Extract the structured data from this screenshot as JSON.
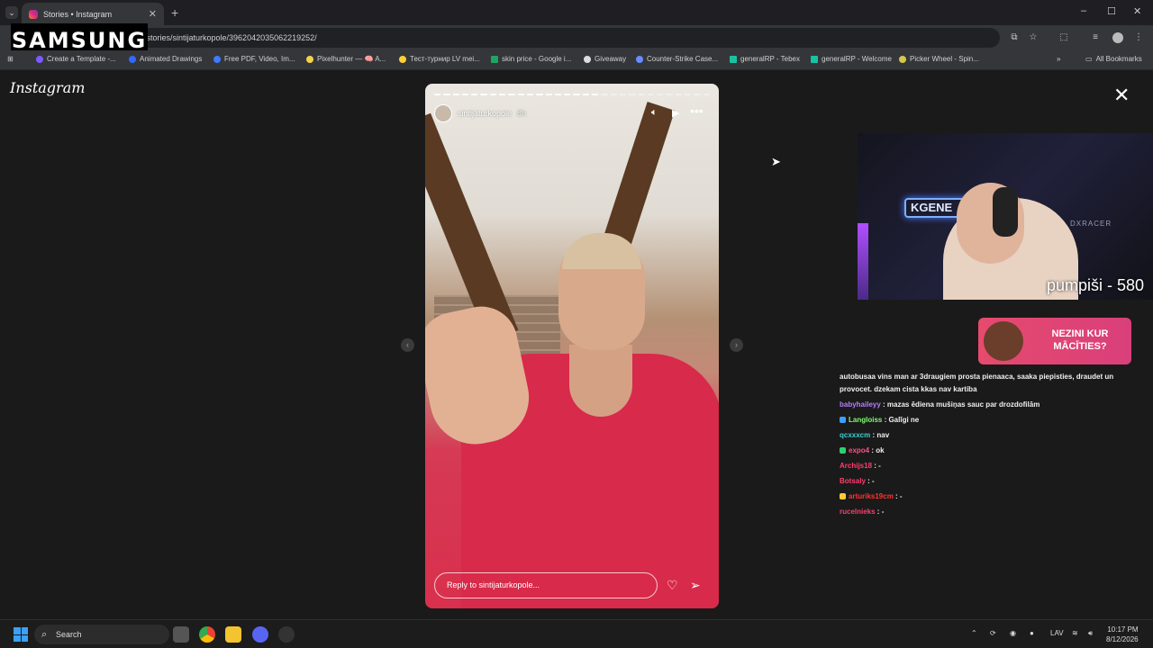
{
  "browser": {
    "tab_title": "Stories • Instagram",
    "new_tab": "+",
    "url": "/stories/sintijaturkopole/3962042035062219252/",
    "window_controls": [
      "–",
      "☐",
      "✕"
    ]
  },
  "watermark": "SAMSUNG",
  "bookmarks": [
    {
      "label": "Create a Template -...",
      "color": "#7c5cff"
    },
    {
      "label": "Animated Drawings",
      "color": "#2f6bff"
    },
    {
      "label": "Free PDF, Video, Im...",
      "color": "#3e7bff"
    },
    {
      "label": "Pixelhunter — 🧠 A...",
      "color": "#f3d34a"
    },
    {
      "label": "Тест-турнир LV mei...",
      "color": "#ffcf33"
    },
    {
      "label": "skin price - Google i...",
      "color": "#1fa463"
    },
    {
      "label": "Giveaway",
      "color": "#dddddd"
    },
    {
      "label": "Counter-Strike Case...",
      "color": "#6b8cff"
    },
    {
      "label": "generalRP - Tebex",
      "color": "#18c2a0"
    },
    {
      "label": "generalRP - Welcome",
      "color": "#18c2a0"
    },
    {
      "label": "Picker Wheel - Spin...",
      "color": "#d5c74a"
    }
  ],
  "bookmarks_overflow": "»",
  "all_bookmarks": "All Bookmarks",
  "instagram": {
    "logo": "Instagram",
    "close": "✕",
    "story": {
      "username": "sintijaturkopole",
      "time": "8h",
      "progress_done": 18,
      "progress_total": 30,
      "reply_placeholder": "Reply to sintijaturkopole..."
    }
  },
  "stream_overlay": {
    "counter": "pumpiši - 580",
    "sign": "KGENE",
    "chair_brand": "DXRACER",
    "ad_text": "NEZINI KUR MĀCĪTIES?"
  },
  "chat": [
    {
      "user": "",
      "text": "autobusaa vins man ar 3draugiem prosta pienaaca, saaka piepisties, draudet un",
      "color": "#ffffff"
    },
    {
      "user": "",
      "text": "provocet. dzekam cista kkas nav kartiba",
      "color": "#ffffff"
    },
    {
      "user": "babyhaileyy",
      "text": ": mazas ēdiena mušiņas sauc par drozdofilām",
      "color": "#b77cff",
      "badge": ""
    },
    {
      "user": "Langloiss",
      "text": ": Galīgi ne",
      "color": "#7cff6b",
      "badge": "#3aa0ff"
    },
    {
      "user": "qcxxxcm",
      "text": ": nav",
      "color": "#3ad0d0",
      "badge": ""
    },
    {
      "user": "expo4",
      "text": ": ok",
      "color": "#ff4f86",
      "badge": "#2fd06b"
    },
    {
      "user": "Archijs18",
      "text": ": -",
      "color": "#ff3d6e",
      "badge": ""
    },
    {
      "user": "Botsaly",
      "text": ": -",
      "color": "#ff3d6e",
      "badge": ""
    },
    {
      "user": "arturiks19cm",
      "text": ": -",
      "color": "#ff3333",
      "badge": "#ffcc33"
    },
    {
      "user": "rucelnieks",
      "text": ": -",
      "color": "#ff3d6e",
      "badge": ""
    }
  ],
  "taskbar": {
    "search_placeholder": "Search",
    "lang": "LAV",
    "time": "10:17 PM",
    "date": "8/12/2026"
  }
}
